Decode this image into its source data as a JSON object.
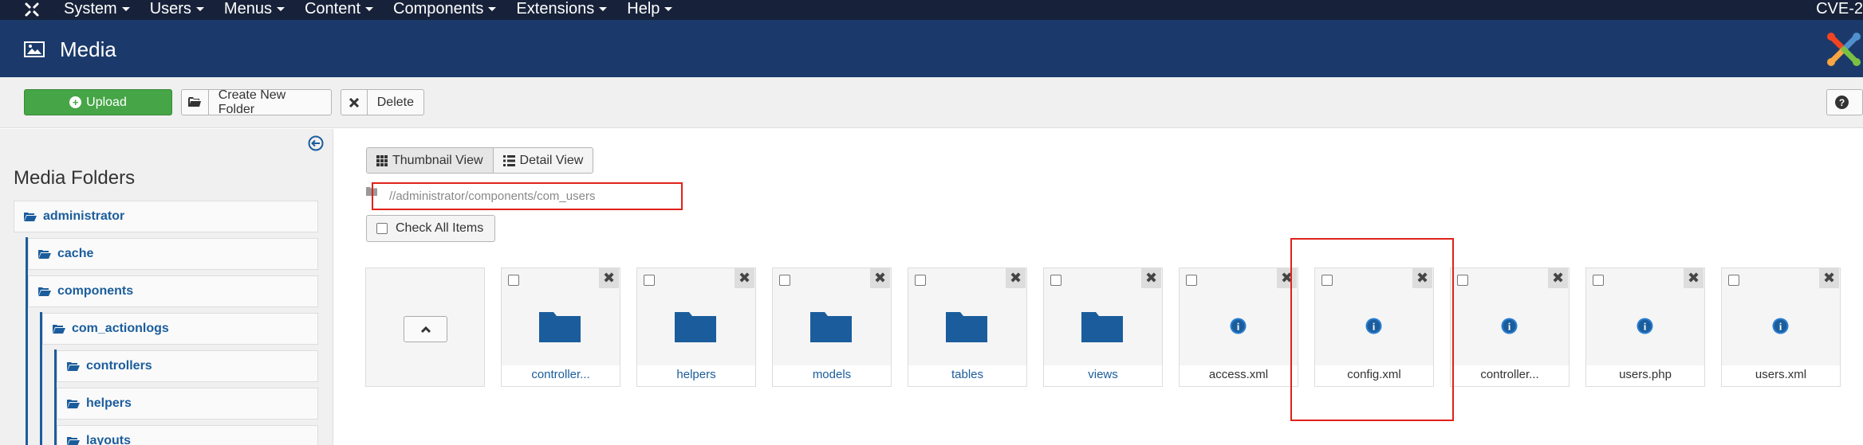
{
  "navbar": {
    "logo_icon": "joomla-icon",
    "menus": [
      {
        "label": "System"
      },
      {
        "label": "Users"
      },
      {
        "label": "Menus"
      },
      {
        "label": "Content"
      },
      {
        "label": "Components"
      },
      {
        "label": "Extensions"
      },
      {
        "label": "Help"
      }
    ],
    "right_text": "CVE-2"
  },
  "header": {
    "icon": "image-icon",
    "title": "Media",
    "logo_icon": "joomla-logo"
  },
  "toolbar": {
    "upload_label": "Upload",
    "create_folder_label": "Create New Folder",
    "delete_label": "Delete",
    "help_icon": "question-icon"
  },
  "sidebar": {
    "title": "Media Folders",
    "items": [
      {
        "label": "administrator"
      },
      {
        "label": "cache"
      },
      {
        "label": "components"
      },
      {
        "label": "com_actionlogs"
      },
      {
        "label": "controllers"
      },
      {
        "label": "helpers"
      },
      {
        "label": "layouts"
      }
    ]
  },
  "main": {
    "thumbnail_view_label": "Thumbnail View",
    "detail_view_label": "Detail View",
    "path": "//administrator/components/com_users",
    "check_all_label": "Check All Items",
    "tiles": [
      {
        "name": "controller...",
        "type": "folder"
      },
      {
        "name": "helpers",
        "type": "folder"
      },
      {
        "name": "models",
        "type": "folder"
      },
      {
        "name": "tables",
        "type": "folder"
      },
      {
        "name": "views",
        "type": "folder"
      },
      {
        "name": "access.xml",
        "type": "file"
      },
      {
        "name": "config.xml",
        "type": "file"
      },
      {
        "name": "controller...",
        "type": "file"
      },
      {
        "name": "users.php",
        "type": "file"
      },
      {
        "name": "users.xml",
        "type": "file"
      }
    ]
  },
  "colors": {
    "navbar": "#17223a",
    "header": "#1b3a6b",
    "upload": "#46a546",
    "link": "#1b5d9c",
    "highlight": "#e0211b"
  }
}
